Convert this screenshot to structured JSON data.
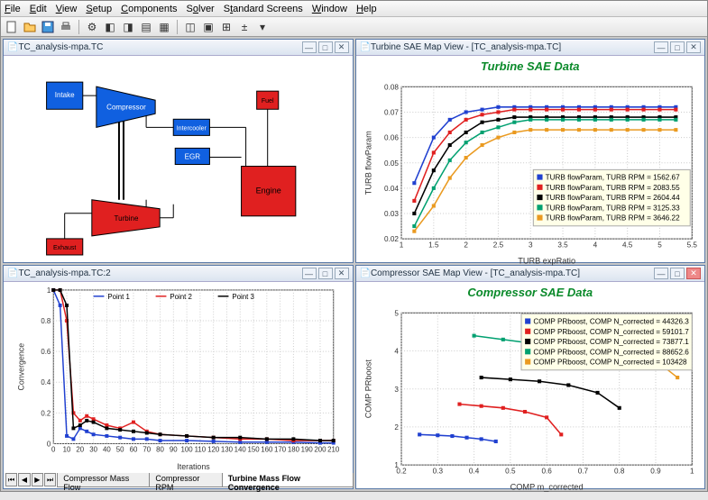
{
  "menus": [
    "File",
    "Edit",
    "View",
    "Setup",
    "Components",
    "Solver",
    "Standard Screens",
    "Window",
    "Help"
  ],
  "panes": {
    "diagram": {
      "title": "TC_analysis-mpa.TC"
    },
    "turbine": {
      "title": "Turbine SAE Map View - [TC_analysis-mpa.TC]"
    },
    "converge": {
      "title": "TC_analysis-mpa.TC:2"
    },
    "compressor": {
      "title": "Compressor SAE Map View - [TC_analysis-mpa.TC]"
    }
  },
  "diagram_blocks": {
    "intake": "Intake",
    "compressor": "Compressor",
    "intercooler": "Intercooler",
    "fuel": "Fuel",
    "egr": "EGR",
    "engine": "Engine",
    "turbine": "Turbine",
    "exhaust": "Exhaust"
  },
  "turbine_chart": {
    "title": "Turbine SAE Data",
    "xlabel": "TURB expRatio",
    "ylabel": "TURB flowParam",
    "xrange": [
      1,
      5.5
    ],
    "yrange": [
      0.02,
      0.08
    ],
    "legend": [
      "TURB flowParam, TURB RPM = 1562.67",
      "TURB flowParam, TURB RPM = 2083.55",
      "TURB flowParam, TURB RPM = 2604.44",
      "TURB flowParam, TURB RPM = 3125.33",
      "TURB flowParam, TURB RPM = 3646.22"
    ]
  },
  "converge_chart": {
    "xlabel": "Iterations",
    "ylabel": "Turbine Mass Flow Convergence",
    "legend": [
      "Point 1",
      "Point 2",
      "Point 3"
    ],
    "xrange": [
      0,
      210
    ],
    "yrange": [
      0,
      1
    ],
    "tabs": [
      "Compressor Mass Flow",
      "Compressor RPM",
      "Turbine Mass Flow Convergence"
    ],
    "active_tab": 2
  },
  "compressor_chart": {
    "title": "Compressor SAE Data",
    "xlabel": "COMP m_corrected",
    "ylabel": "COMP PRboost",
    "xrange": [
      0.2,
      1.0
    ],
    "yrange": [
      1,
      5
    ],
    "legend": [
      "COMP PRboost, COMP N_corrected = 44326.3",
      "COMP PRboost, COMP N_corrected = 59101.7",
      "COMP PRboost, COMP N_corrected = 73877.1",
      "COMP PRboost, COMP N_corrected = 88652.6",
      "COMP PRboost, COMP N_corrected = 103428"
    ]
  },
  "chart_data": [
    {
      "type": "line",
      "title": "Turbine SAE Data",
      "xlabel": "TURB expRatio",
      "ylabel": "TURB flowParam",
      "x": [
        1.2,
        1.5,
        1.75,
        2.0,
        2.25,
        2.5,
        2.75,
        3.0,
        3.25,
        3.5,
        3.75,
        4.0,
        4.25,
        4.5,
        4.75,
        5.0,
        5.25
      ],
      "series": [
        {
          "name": "RPM 1562.67",
          "values": [
            0.042,
            0.06,
            0.067,
            0.07,
            0.071,
            0.072,
            0.072,
            0.072,
            0.072,
            0.072,
            0.072,
            0.072,
            0.072,
            0.072,
            0.072,
            0.072,
            0.072
          ]
        },
        {
          "name": "RPM 2083.55",
          "values": [
            0.035,
            0.054,
            0.062,
            0.067,
            0.069,
            0.07,
            0.071,
            0.071,
            0.071,
            0.071,
            0.071,
            0.071,
            0.071,
            0.071,
            0.071,
            0.071,
            0.071
          ]
        },
        {
          "name": "RPM 2604.44",
          "values": [
            0.03,
            0.047,
            0.057,
            0.062,
            0.066,
            0.067,
            0.068,
            0.068,
            0.068,
            0.068,
            0.068,
            0.068,
            0.068,
            0.068,
            0.068,
            0.068,
            0.068
          ]
        },
        {
          "name": "RPM 3125.33",
          "values": [
            0.025,
            0.04,
            0.051,
            0.058,
            0.062,
            0.064,
            0.066,
            0.067,
            0.067,
            0.067,
            0.067,
            0.067,
            0.067,
            0.067,
            0.067,
            0.067,
            0.067
          ]
        },
        {
          "name": "RPM 3646.22",
          "values": [
            0.023,
            0.033,
            0.044,
            0.052,
            0.057,
            0.06,
            0.062,
            0.063,
            0.063,
            0.063,
            0.063,
            0.063,
            0.063,
            0.063,
            0.063,
            0.063,
            0.063
          ]
        }
      ],
      "xlim": [
        1,
        5.5
      ],
      "ylim": [
        0.02,
        0.08
      ]
    },
    {
      "type": "line",
      "title": "Turbine Mass Flow Convergence",
      "xlabel": "Iterations",
      "ylabel": "Convergence",
      "x": [
        0,
        5,
        10,
        15,
        20,
        25,
        30,
        40,
        50,
        60,
        70,
        80,
        100,
        120,
        140,
        160,
        180,
        200,
        210
      ],
      "series": [
        {
          "name": "Point 1",
          "values": [
            1.0,
            0.9,
            0.05,
            0.03,
            0.1,
            0.08,
            0.06,
            0.05,
            0.04,
            0.03,
            0.03,
            0.02,
            0.02,
            0.015,
            0.01,
            0.01,
            0.01,
            0.005,
            0.005
          ]
        },
        {
          "name": "Point 2",
          "values": [
            1.0,
            1.0,
            0.8,
            0.2,
            0.15,
            0.18,
            0.16,
            0.12,
            0.1,
            0.14,
            0.08,
            0.06,
            0.05,
            0.04,
            0.03,
            0.03,
            0.02,
            0.02,
            0.02
          ]
        },
        {
          "name": "Point 3",
          "values": [
            1.0,
            1.0,
            0.9,
            0.1,
            0.12,
            0.15,
            0.14,
            0.1,
            0.09,
            0.08,
            0.07,
            0.06,
            0.05,
            0.04,
            0.04,
            0.03,
            0.03,
            0.02,
            0.02
          ]
        }
      ],
      "xlim": [
        0,
        210
      ],
      "ylim": [
        0,
        1
      ]
    },
    {
      "type": "line",
      "title": "Compressor SAE Data",
      "xlabel": "COMP m_corrected",
      "ylabel": "COMP PRboost",
      "series": [
        {
          "name": "N 44326.3",
          "x": [
            0.25,
            0.3,
            0.34,
            0.38,
            0.42,
            0.46
          ],
          "y": [
            1.8,
            1.78,
            1.76,
            1.72,
            1.68,
            1.62
          ]
        },
        {
          "name": "N 59101.7",
          "x": [
            0.36,
            0.42,
            0.48,
            0.54,
            0.6,
            0.64
          ],
          "y": [
            2.6,
            2.55,
            2.5,
            2.4,
            2.25,
            1.8
          ]
        },
        {
          "name": "N 73877.1",
          "x": [
            0.42,
            0.5,
            0.58,
            0.66,
            0.74,
            0.8
          ],
          "y": [
            3.3,
            3.25,
            3.2,
            3.1,
            2.9,
            2.5
          ]
        },
        {
          "name": "N 88652.6",
          "x": [
            0.4,
            0.48,
            0.56,
            0.64,
            0.7
          ],
          "y": [
            4.4,
            4.3,
            4.2,
            4.05,
            3.6
          ]
        },
        {
          "name": "N 103428",
          "x": [
            0.58,
            0.66,
            0.74,
            0.82,
            0.9,
            0.96
          ],
          "y": [
            4.1,
            4.05,
            4.0,
            3.9,
            3.75,
            3.3
          ]
        }
      ],
      "xlim": [
        0.2,
        1.0
      ],
      "ylim": [
        1,
        5
      ]
    }
  ]
}
